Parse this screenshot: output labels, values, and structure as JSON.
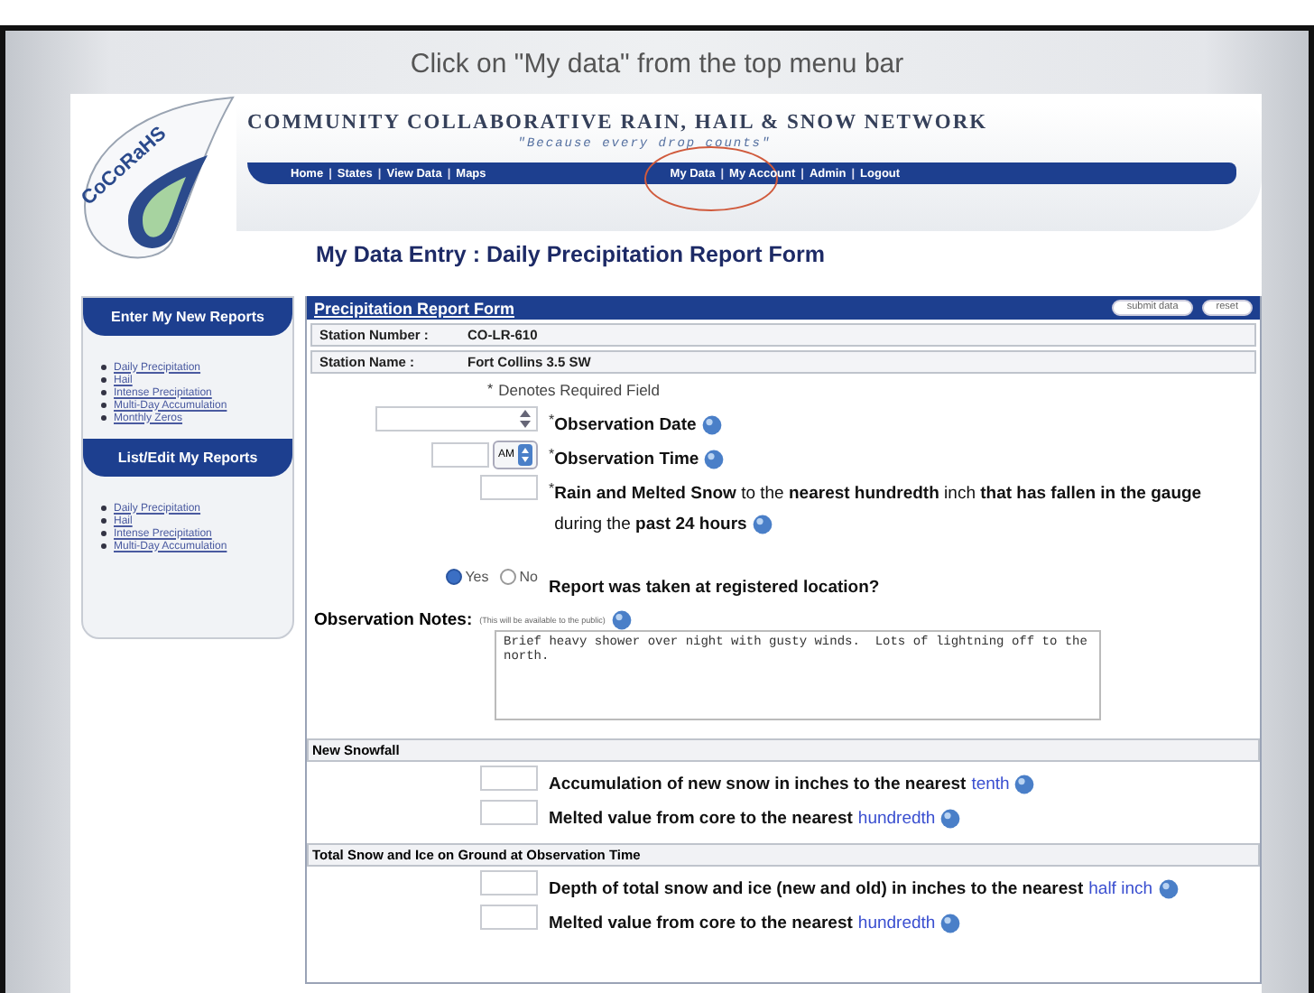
{
  "slide": {
    "caption": "Click on \"My data\" from the top menu bar"
  },
  "site": {
    "logo": "CoCoRaHS",
    "title": "COMMUNITY COLLABORATIVE RAIN, HAIL & SNOW NETWORK",
    "slogan": "\"Because every drop counts\"",
    "separator": "|",
    "nav_left": [
      {
        "label": "Home",
        "highlighted": false
      },
      {
        "label": "States",
        "highlighted": false
      },
      {
        "label": "View Data",
        "highlighted": false
      },
      {
        "label": "Maps",
        "highlighted": false
      }
    ],
    "nav_right": [
      {
        "label": "My Data",
        "highlighted": true
      },
      {
        "label": "My Account",
        "highlighted": false
      },
      {
        "label": "Admin",
        "highlighted": false
      },
      {
        "label": "Logout",
        "highlighted": false
      }
    ]
  },
  "page_title": "My Data Entry : Daily Precipitation Report Form",
  "sidebar": {
    "sections": [
      {
        "heading": "Enter My New Reports",
        "links": [
          "Daily Precipitation",
          "Hail",
          "Intense Precipitation",
          "Multi-Day Accumulation",
          "Monthly Zeros"
        ]
      },
      {
        "heading": "List/Edit My Reports",
        "links": [
          "Daily Precipitation",
          "Hail",
          "Intense Precipitation",
          "Multi-Day Accumulation"
        ]
      }
    ]
  },
  "form": {
    "header": "Precipitation Report Form",
    "buttons": [
      "submit data",
      "reset"
    ],
    "station": [
      {
        "label": "Station Number :",
        "value": "CO-LR-610"
      },
      {
        "label": "Station Name :",
        "value": "Fort Collins 3.5 SW"
      }
    ],
    "required_note": {
      "marker": "*",
      "text": "Denotes Required Field"
    },
    "fields": [
      {
        "kind": "date",
        "marker": "*",
        "label": "Observation Date",
        "help": true
      },
      {
        "kind": "time",
        "marker": "*",
        "label": "Observation Time",
        "ampm": "AM",
        "help": true
      },
      {
        "kind": "amount",
        "marker": "*",
        "label": "**Rain and Melted Snow** to the **nearest hundredth** inch **that has fallen in the gauge** during the **past 24 hours**",
        "help": true
      },
      {
        "kind": "radio",
        "label": "Report was taken at registered location?",
        "options": [
          {
            "label": "Yes",
            "selected": true
          },
          {
            "label": "No",
            "selected": false
          }
        ]
      }
    ],
    "notes": {
      "label": "Observation Notes:",
      "hint": "(This will be available to the public)",
      "help": true,
      "value": "Brief heavy shower over night with gusty winds.  Lots of lightning off to the north."
    },
    "sections": [
      {
        "heading": "New Snowfall",
        "rows": [
          {
            "text": "Accumulation of new snow in inches to the nearest",
            "link": "tenth",
            "help": true
          },
          {
            "text": "Melted value from core to the nearest",
            "link": "hundredth",
            "help": true
          }
        ]
      },
      {
        "heading": "Total Snow and Ice on Ground at Observation Time",
        "rows": [
          {
            "text": "Depth of total snow and ice (new and old) in inches to the nearest",
            "link": "half inch",
            "help": true
          },
          {
            "text": "Melted value from core to the nearest",
            "link": "hundredth",
            "help": true
          }
        ]
      }
    ]
  }
}
